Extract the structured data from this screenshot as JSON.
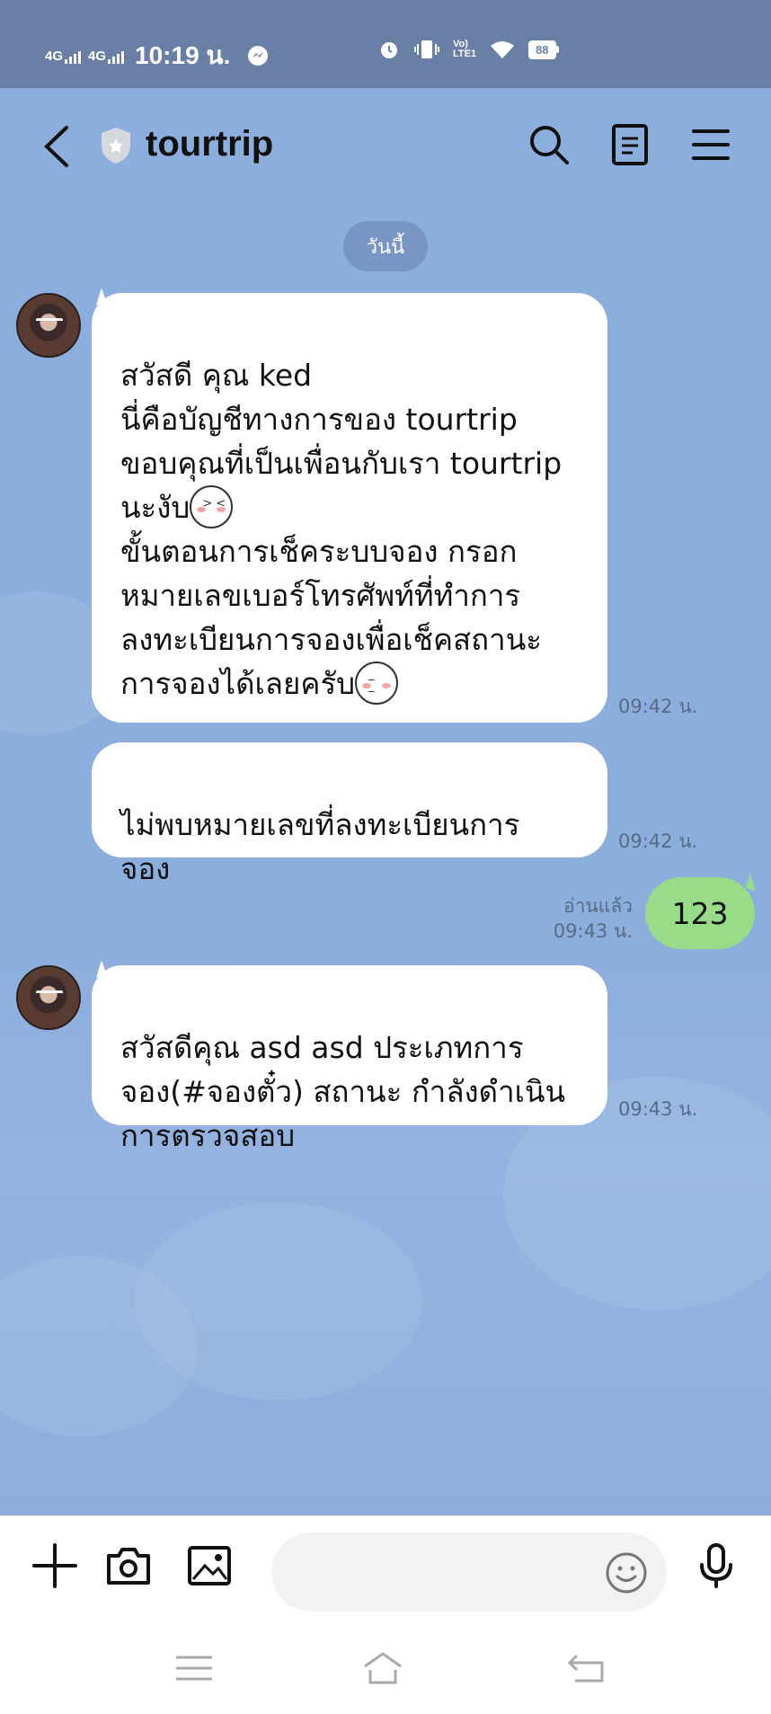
{
  "status_bar": {
    "signal1": "4G",
    "signal2": "4G",
    "time": "10:19 น.",
    "battery": "88"
  },
  "header": {
    "title": "tourtrip"
  },
  "date_divider": "วันนี้",
  "messages": [
    {
      "text": "สวัสดี คุณ ked\nนี่คือบัญชีทางการของ tourtrip\nขอบคุณที่เป็นเพื่อนกับเรา tourtrip\nนะงับ",
      "text2": "\nขั้นตอนการเช็คระบบจอง กรอก\nหมายเลขเบอร์โทรศัพท์ที่ทำการ\nลงทะเบียนการจองเพื่อเช็คสถานะ\nการจองได้เลยครับ",
      "time": "09:42 น."
    },
    {
      "text": "ไม่พบหมายเลขที่ลงทะเบียนการ\nจอง",
      "time": "09:42 น."
    },
    {
      "text": "สวัสดีคุณ asd asd ประเภทการ\nจอง(#จองตั๋ว) สถานะ กำลังดำเนิน\nการตรวจสอบ",
      "time": "09:43 น."
    }
  ],
  "outgoing": {
    "text": "123",
    "read": "อ่านแล้ว",
    "time": "09:43 น."
  },
  "input": {
    "placeholder": ""
  },
  "colors": {
    "chat_bg": "#8caedd",
    "outgoing_bubble": "#98dc8a",
    "status_bar": "#6a7fa6"
  }
}
